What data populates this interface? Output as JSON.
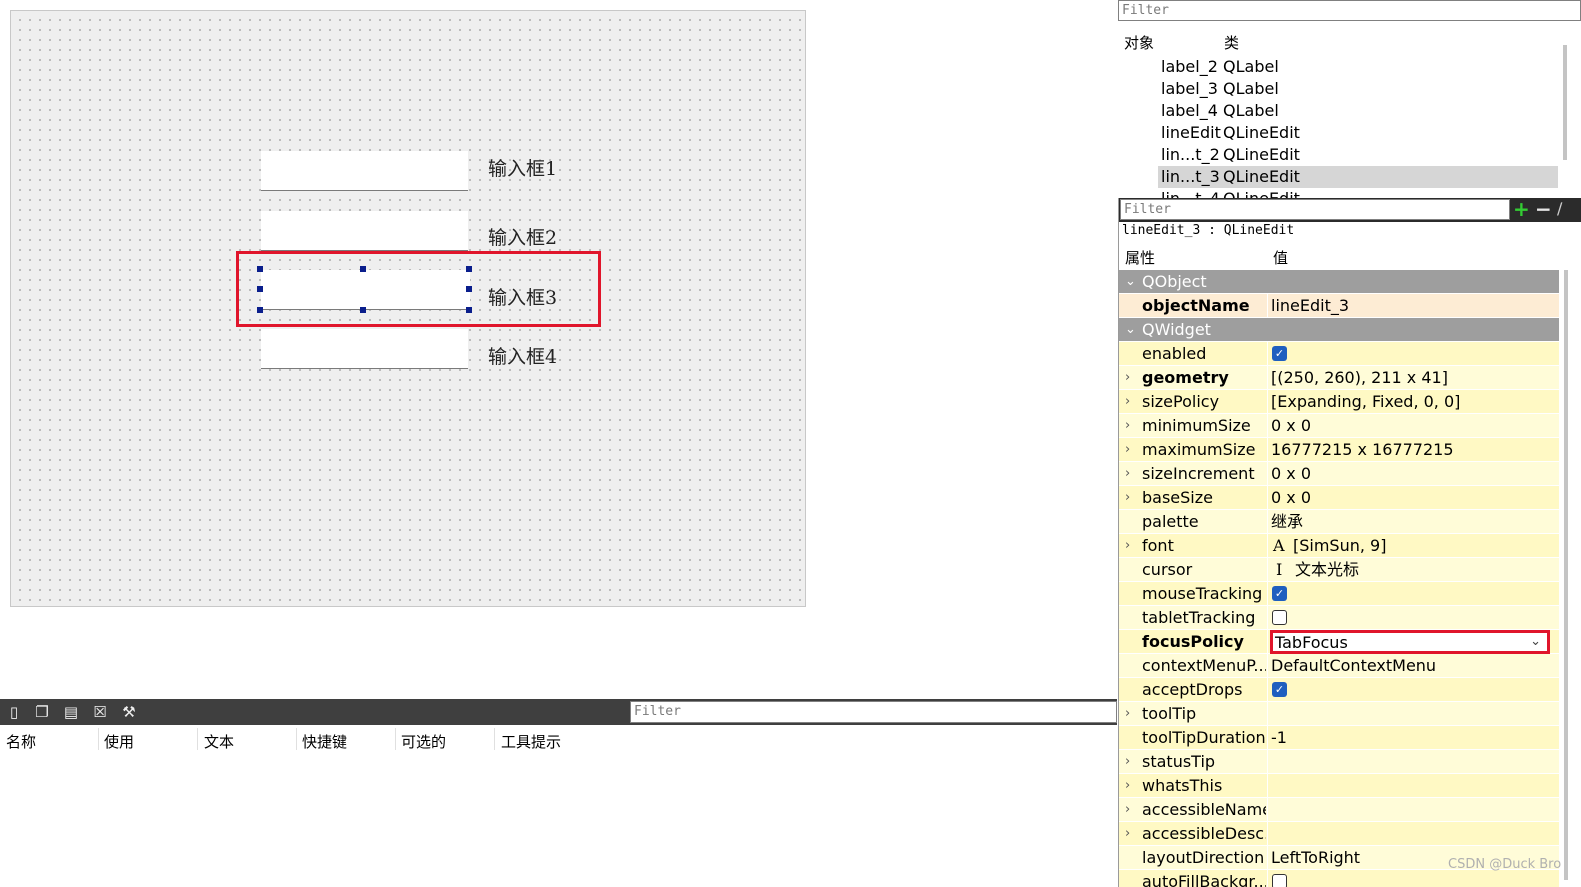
{
  "form": {
    "labels": [
      "输入框1",
      "输入框2",
      "输入框3",
      "输入框4"
    ]
  },
  "object_inspector": {
    "filter_placeholder": "Filter",
    "header_object": "对象",
    "header_class": "类",
    "rows": [
      {
        "name": "label_2",
        "class": "QLabel"
      },
      {
        "name": "label_3",
        "class": "QLabel"
      },
      {
        "name": "label_4",
        "class": "QLabel"
      },
      {
        "name": "lineEdit",
        "class": "QLineEdit"
      },
      {
        "name": "lin...t_2",
        "class": "QLineEdit"
      },
      {
        "name": "lin...t_3",
        "class": "QLineEdit"
      },
      {
        "name": "lin...t_4",
        "class": "QLineEdit"
      }
    ]
  },
  "property_editor": {
    "filter_placeholder": "Filter",
    "add_symbol": "+",
    "remove_symbol": "−",
    "object_title": "lineEdit_3 : QLineEdit",
    "header_property": "属性",
    "header_value": "值",
    "groups": {
      "qobject": "QObject",
      "qwidget": "QWidget"
    },
    "object_name": {
      "name": "objectName",
      "value": "lineEdit_3"
    },
    "props": {
      "enabled": {
        "name": "enabled",
        "checked": true
      },
      "geometry": {
        "name": "geometry",
        "value": "[(250, 260), 211 x 41]"
      },
      "sizePolicy": {
        "name": "sizePolicy",
        "value": "[Expanding, Fixed, 0, 0]"
      },
      "minimumSize": {
        "name": "minimumSize",
        "value": "0 x 0"
      },
      "maximumSize": {
        "name": "maximumSize",
        "value": "16777215 x 16777215"
      },
      "sizeIncrement": {
        "name": "sizeIncrement",
        "value": "0 x 0"
      },
      "baseSize": {
        "name": "baseSize",
        "value": "0 x 0"
      },
      "palette": {
        "name": "palette",
        "value": "继承"
      },
      "font": {
        "name": "font",
        "glyph": "A",
        "value": "[SimSun, 9]"
      },
      "cursor": {
        "name": "cursor",
        "glyph": "I",
        "value": "文本光标"
      },
      "mouseTracking": {
        "name": "mouseTracking",
        "checked": true
      },
      "tabletTracking": {
        "name": "tabletTracking",
        "checked": false
      },
      "focusPolicy": {
        "name": "focusPolicy",
        "value": "TabFocus"
      },
      "contextMenuPolicy": {
        "name": "contextMenuP...",
        "value": "DefaultContextMenu"
      },
      "acceptDrops": {
        "name": "acceptDrops",
        "checked": true
      },
      "toolTip": {
        "name": "toolTip",
        "value": ""
      },
      "toolTipDuration": {
        "name": "toolTipDuration",
        "value": "-1"
      },
      "statusTip": {
        "name": "statusTip",
        "value": ""
      },
      "whatsThis": {
        "name": "whatsThis",
        "value": ""
      },
      "accessibleName": {
        "name": "accessibleName",
        "value": ""
      },
      "accessibleDescription": {
        "name": "accessibleDesc...",
        "value": ""
      },
      "layoutDirection": {
        "name": "layoutDirection",
        "value": "LeftToRight"
      },
      "autoFillBackground": {
        "name": "autoFillBackgr...",
        "checked": false
      }
    }
  },
  "action_editor": {
    "filter_placeholder": "Filter",
    "columns": [
      "名称",
      "使用",
      "文本",
      "快捷键",
      "可选的",
      "工具提示"
    ]
  },
  "watermark": "CSDN @Duck Bro",
  "colors": {
    "highlight_red": "#e0152b",
    "group_gray": "#9e9e9e",
    "property_yellow": "#fff9c4",
    "selection_blue": "#0a1e8c"
  }
}
